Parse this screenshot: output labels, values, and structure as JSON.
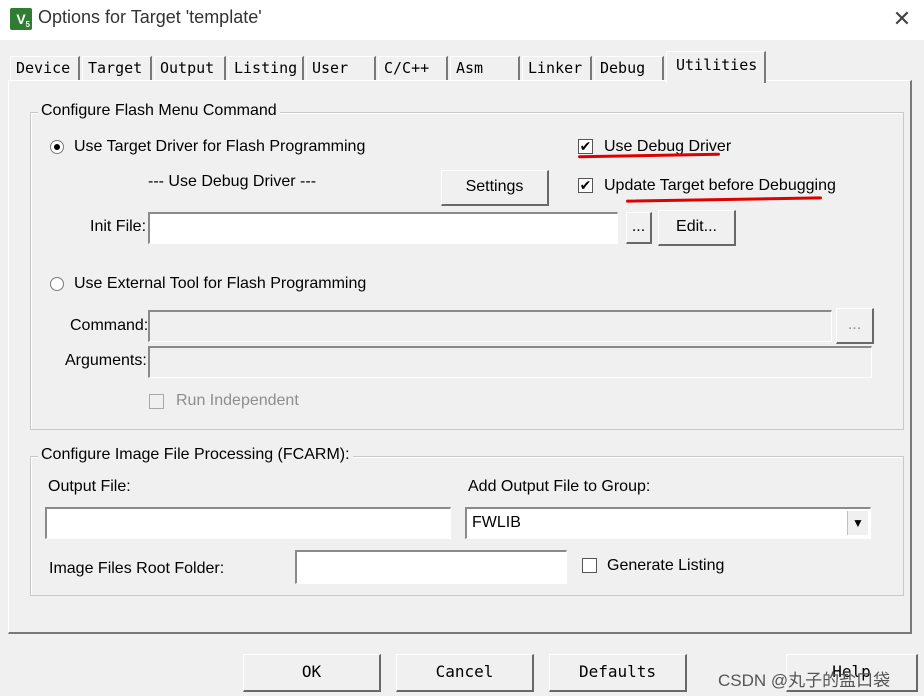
{
  "window": {
    "title": "Options for Target 'template'",
    "close_glyph": "✕",
    "icon": "keil-uv-icon"
  },
  "tabs": [
    "Device",
    "Target",
    "Output",
    "Listing",
    "User",
    "C/C++",
    "Asm",
    "Linker",
    "Debug",
    "Utilities"
  ],
  "active_tab": "Utilities",
  "flash_group": {
    "legend": "Configure Flash Menu Command",
    "use_target_driver_label": "Use Target Driver for Flash Programming",
    "driver_select_value": "--- Use Debug Driver ---",
    "settings_label": "Settings",
    "use_debug_driver_label": "Use Debug Driver",
    "use_debug_driver_checked": true,
    "update_target_label": "Update Target before Debugging",
    "update_target_checked": true,
    "init_file_label": "Init File:",
    "init_file_value": "",
    "browse_label": "...",
    "edit_label": "Edit...",
    "use_external_tool_label": "Use External Tool for Flash Programming",
    "command_label": "Command:",
    "command_value": "",
    "arguments_label": "Arguments:",
    "arguments_value": "",
    "run_independent_label": "Run Independent",
    "run_independent_checked": false
  },
  "image_group": {
    "legend": "Configure Image File Processing (FCARM):",
    "output_file_label": "Output File:",
    "output_file_value": "",
    "add_output_label": "Add Output File  to Group:",
    "group_value": "FWLIB",
    "root_folder_label": "Image Files Root Folder:",
    "root_folder_value": "",
    "generate_listing_label": "Generate Listing",
    "generate_listing_checked": false
  },
  "footer_buttons": {
    "ok": "OK",
    "cancel": "Cancel",
    "defaults": "Defaults",
    "help": "Help"
  },
  "watermark": "CSDN @丸子的盐口袋",
  "annotation_color": "#e00000"
}
